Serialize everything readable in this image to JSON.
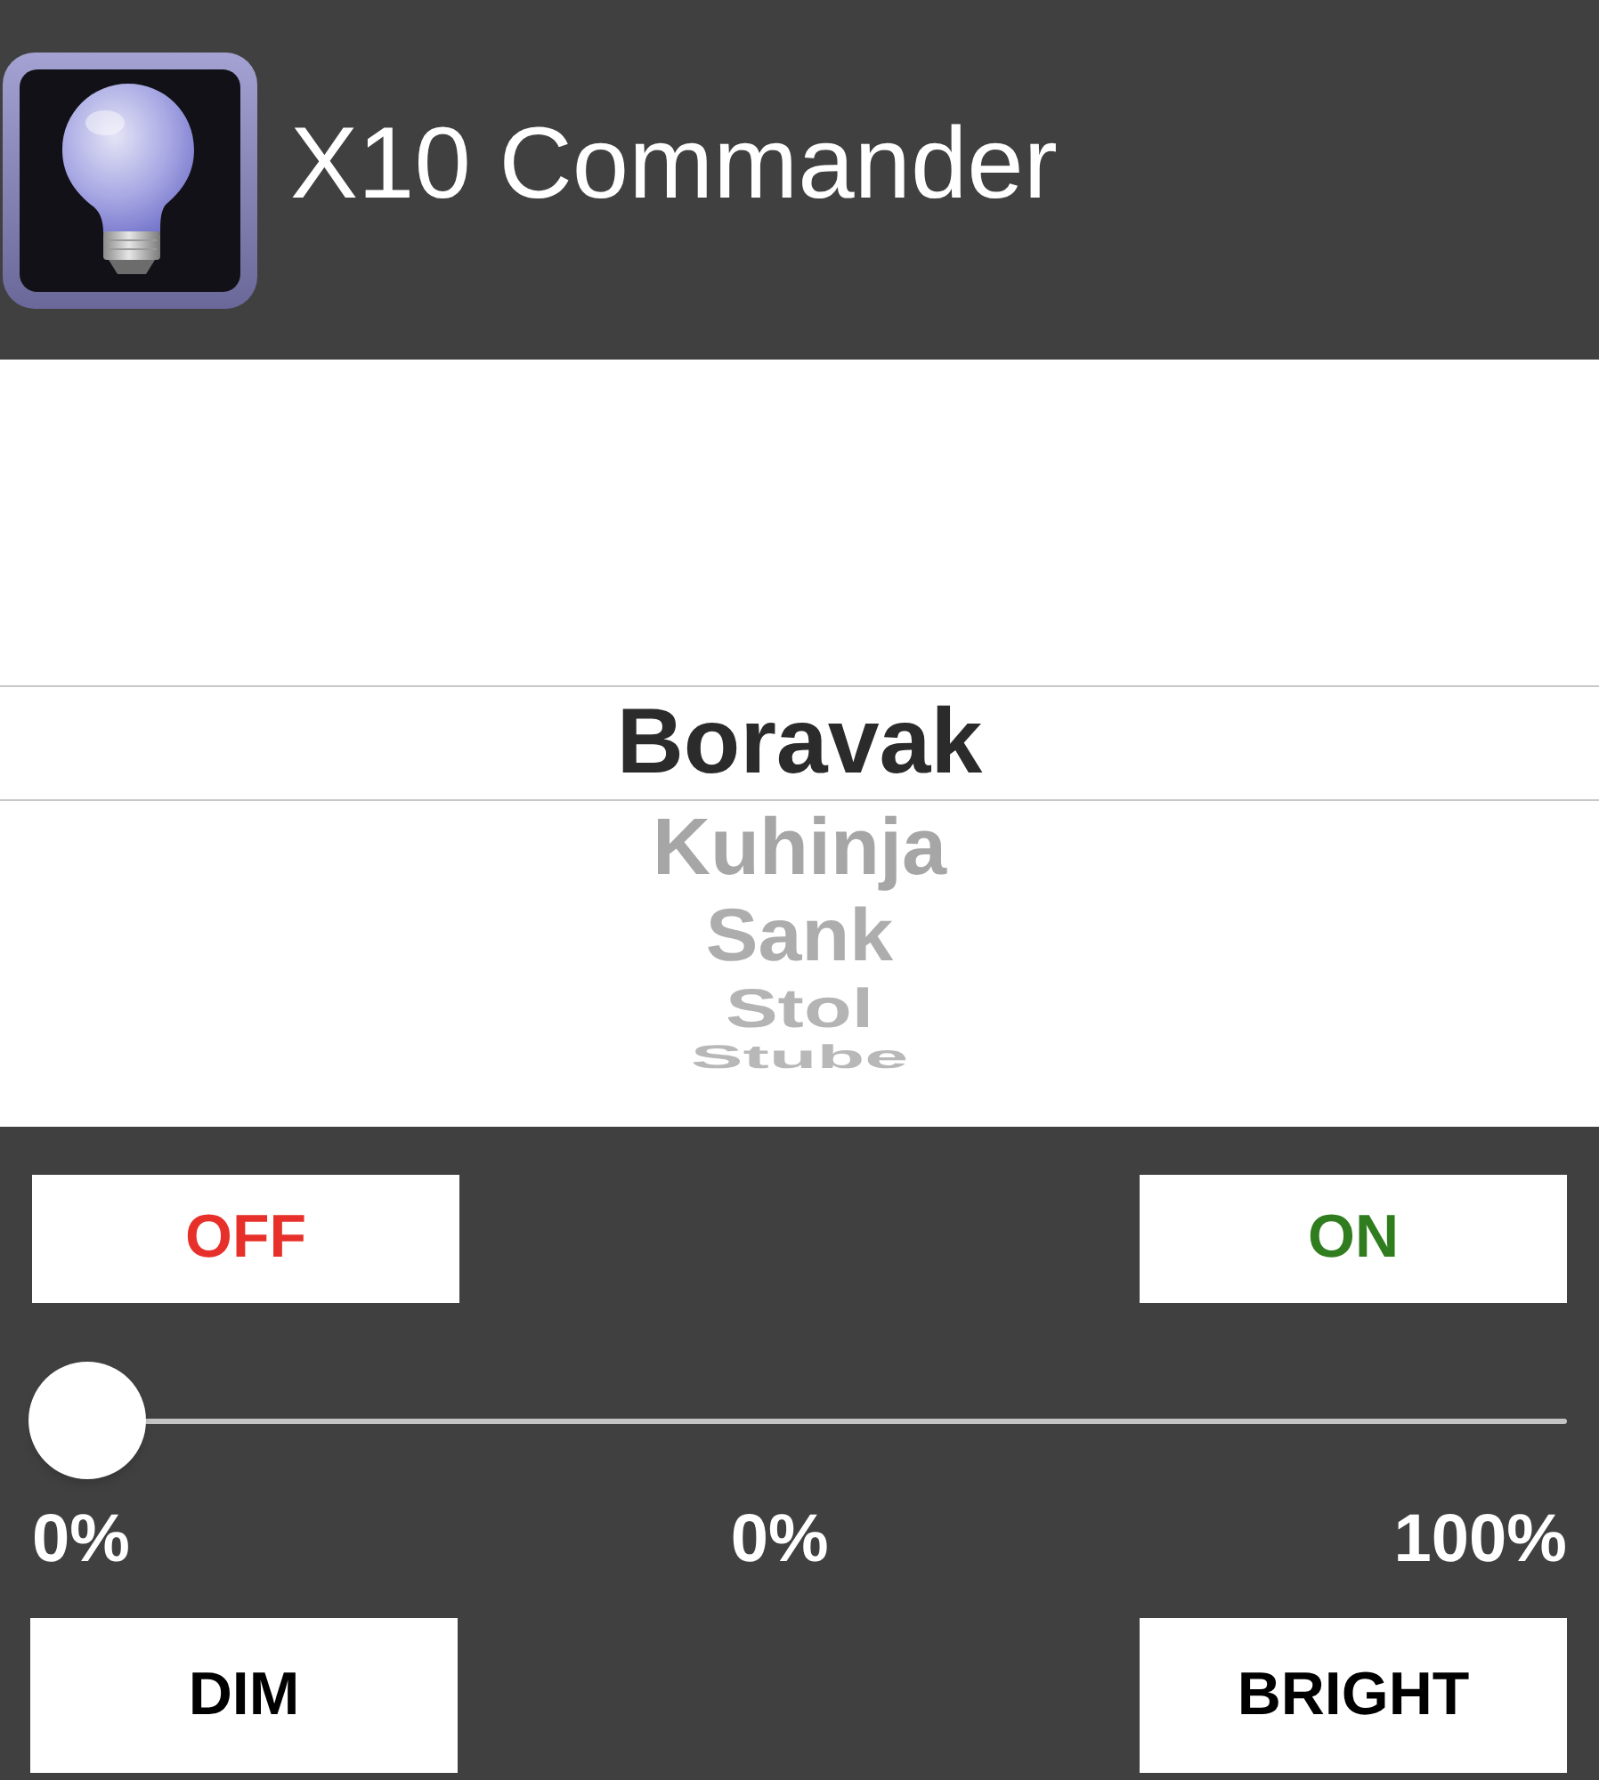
{
  "app_bar": {
    "title": "X10 Commander"
  },
  "picker": {
    "items": [
      {
        "label": "Boravak",
        "selected": true
      },
      {
        "label": "Kuhinja",
        "selected": false
      },
      {
        "label": "Sank",
        "selected": false
      },
      {
        "label": "Stol",
        "selected": false
      },
      {
        "label": "Stube",
        "selected": false
      }
    ]
  },
  "controls": {
    "top_buttons": [
      {
        "label": "OFF",
        "color": "#e8302a"
      },
      {
        "label": "ON",
        "color": "#2f7d1f"
      }
    ],
    "slider": {
      "level": 0,
      "min_label": "0%",
      "value_label": "0%",
      "max_label": "100%"
    },
    "bottom_buttons": [
      {
        "label": "DIM"
      },
      {
        "label": "BRIGHT"
      }
    ]
  }
}
